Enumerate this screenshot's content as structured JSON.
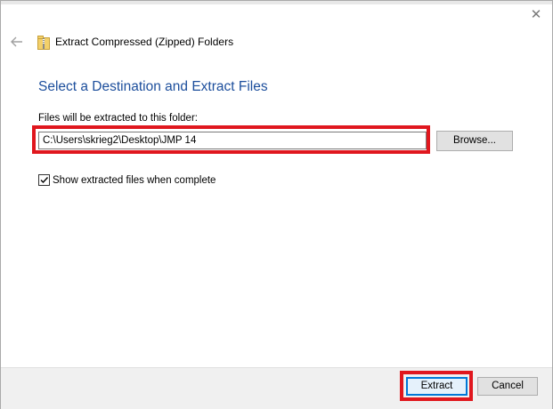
{
  "window": {
    "close_symbol": "✕"
  },
  "wizard": {
    "title": "Extract Compressed (Zipped) Folders",
    "heading": "Select a Destination and Extract Files",
    "destination_label": "Files will be extracted to this folder:",
    "destination_value": "C:\\Users\\skrieg2\\Desktop\\JMP 14",
    "browse_label": "Browse...",
    "show_files_label": "Show extracted files when complete",
    "show_files_checked": true
  },
  "footer": {
    "extract_label": "Extract",
    "cancel_label": "Cancel"
  },
  "icons": {
    "back": "back-arrow-icon",
    "folder": "zip-folder-icon",
    "close": "close-icon",
    "check": "checkmark-icon"
  },
  "colors": {
    "heading": "#1c4e9c",
    "highlight": "#e0171e",
    "default_button_border": "#0078d7",
    "footer_background": "#f0f0f0"
  }
}
